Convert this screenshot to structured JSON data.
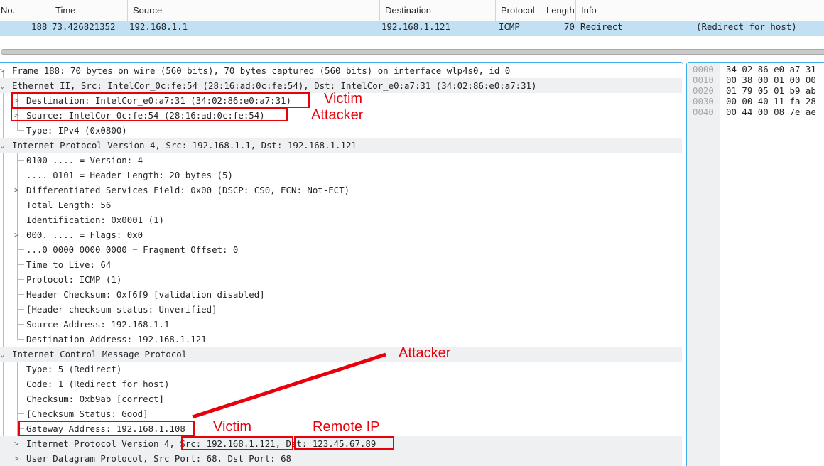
{
  "packet_list": {
    "columns": [
      "No.",
      "Time",
      "Source",
      "Destination",
      "Protocol",
      "Length",
      "Info"
    ],
    "selected_row": {
      "no": "188",
      "time": "73.426821352",
      "source": "192.168.1.1",
      "destination": "192.168.1.121",
      "protocol": "ICMP",
      "length": "70",
      "info": "Redirect",
      "info_detail": "(Redirect for host)"
    },
    "selection_color": "#c2e0f4"
  },
  "tree": {
    "rows": [
      "Frame 188: 70 bytes on wire (560 bits), 70 bytes captured (560 bits) on interface wlp4s0, id 0",
      "Ethernet II, Src: IntelCor_0c:fe:54 (28:16:ad:0c:fe:54), Dst: IntelCor_e0:a7:31 (34:02:86:e0:a7:31)",
      "Destination: IntelCor_e0:a7:31 (34:02:86:e0:a7:31)",
      "Source: IntelCor_0c:fe:54 (28:16:ad:0c:fe:54)",
      "Type: IPv4 (0x0800)",
      "Internet Protocol Version 4, Src: 192.168.1.1, Dst: 192.168.1.121",
      "0100 .... = Version: 4",
      ".... 0101 = Header Length: 20 bytes (5)",
      "Differentiated Services Field: 0x00 (DSCP: CS0, ECN: Not-ECT)",
      "Total Length: 56",
      "Identification: 0x0001 (1)",
      "000. .... = Flags: 0x0",
      "...0 0000 0000 0000 = Fragment Offset: 0",
      "Time to Live: 64",
      "Protocol: ICMP (1)",
      "Header Checksum: 0xf6f9 [validation disabled]",
      "[Header checksum status: Unverified]",
      "Source Address: 192.168.1.1",
      "Destination Address: 192.168.1.121",
      "Internet Control Message Protocol",
      "Type: 5 (Redirect)",
      "Code: 1 (Redirect for host)",
      "Checksum: 0xb9ab [correct]",
      "[Checksum Status: Good]",
      "Gateway Address: 192.168.1.108",
      "Internet Protocol Version 4, Src: 192.168.1.121, Dst: 123.45.67.89",
      "User Datagram Protocol, Src Port: 68, Dst Port: 68"
    ]
  },
  "hex": {
    "lines": [
      {
        "offset": "0000",
        "bytes": "34 02 86 e0 a7 31"
      },
      {
        "offset": "0010",
        "bytes": "00 38 00 01 00 00"
      },
      {
        "offset": "0020",
        "bytes": "01 79 05 01 b9 ab"
      },
      {
        "offset": "0030",
        "bytes": "00 00 40 11 fa 28"
      },
      {
        "offset": "0040",
        "bytes": "00 44 00 08 7e ae"
      }
    ]
  },
  "annotations": {
    "victim_mac": "Victim",
    "attacker_mac": "Attacker",
    "attacker_gateway": "Attacker",
    "victim_ip": "Victim",
    "remote_ip": "Remote IP",
    "color": "#e8000b"
  }
}
